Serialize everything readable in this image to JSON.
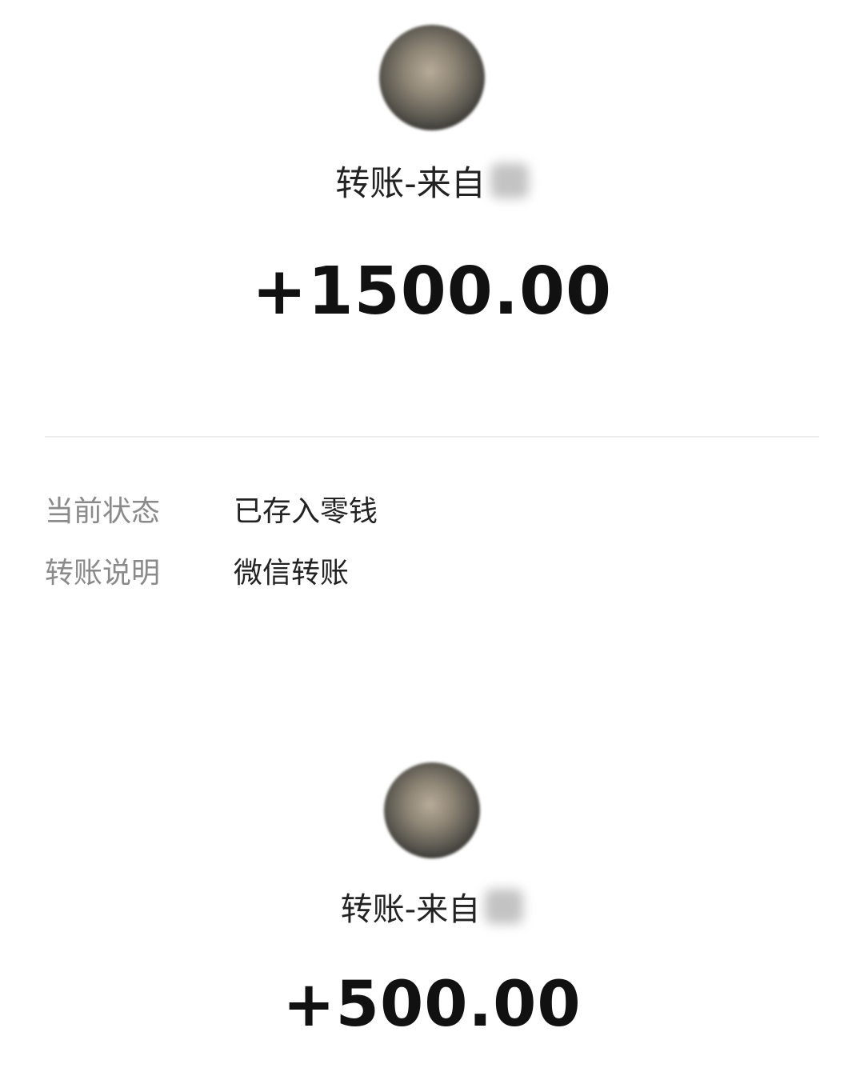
{
  "transfer_1": {
    "from_text": "转账-来自",
    "amount": "+1500.00",
    "details": [
      {
        "label": "当前状态",
        "value": "已存入零钱"
      },
      {
        "label": "转账说明",
        "value": "微信转账"
      }
    ]
  },
  "transfer_2": {
    "from_text": "转账-来自",
    "amount": "+500.00"
  }
}
